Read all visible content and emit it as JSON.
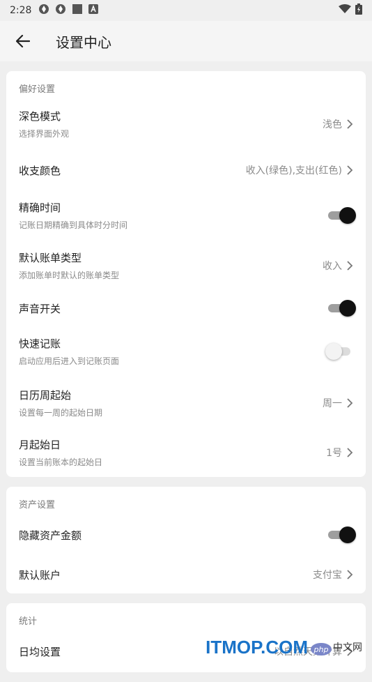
{
  "status_bar": {
    "time": "2:28"
  },
  "header": {
    "title": "设置中心"
  },
  "sections": [
    {
      "title": "偏好设置",
      "rows": [
        {
          "title": "深色模式",
          "subtitle": "选择界面外观",
          "value": "浅色"
        },
        {
          "title": "收支颜色",
          "value": "收入(绿色),支出(红色)"
        },
        {
          "title": "精确时间",
          "subtitle": "记账日期精确到具体时分时间",
          "toggle": true
        },
        {
          "title": "默认账单类型",
          "subtitle": "添加账单时默认的账单类型",
          "value": "收入"
        },
        {
          "title": "声音开关",
          "toggle": true
        },
        {
          "title": "快速记账",
          "subtitle": "启动应用后进入到记账页面",
          "toggle": false
        },
        {
          "title": "日历周起始",
          "subtitle": "设置每一周的起始日期",
          "value": "周一"
        },
        {
          "title": "月起始日",
          "subtitle": "设置当前账本的起始日",
          "value": "1号"
        }
      ]
    },
    {
      "title": "资产设置",
      "rows": [
        {
          "title": "隐藏资产金额",
          "toggle": true
        },
        {
          "title": "默认账户",
          "value": "支付宝"
        }
      ]
    },
    {
      "title": "统计",
      "rows": [
        {
          "title": "日均设置",
          "value": "以自然天数计算"
        }
      ]
    }
  ],
  "watermark": {
    "main": "ITMOP.COM",
    "badge": "php",
    "cn": "中文网"
  },
  "colors": {
    "background": "#efefef",
    "card": "#ffffff",
    "toggle_thumb_on": "#111111",
    "watermark": "#1a73c8"
  }
}
